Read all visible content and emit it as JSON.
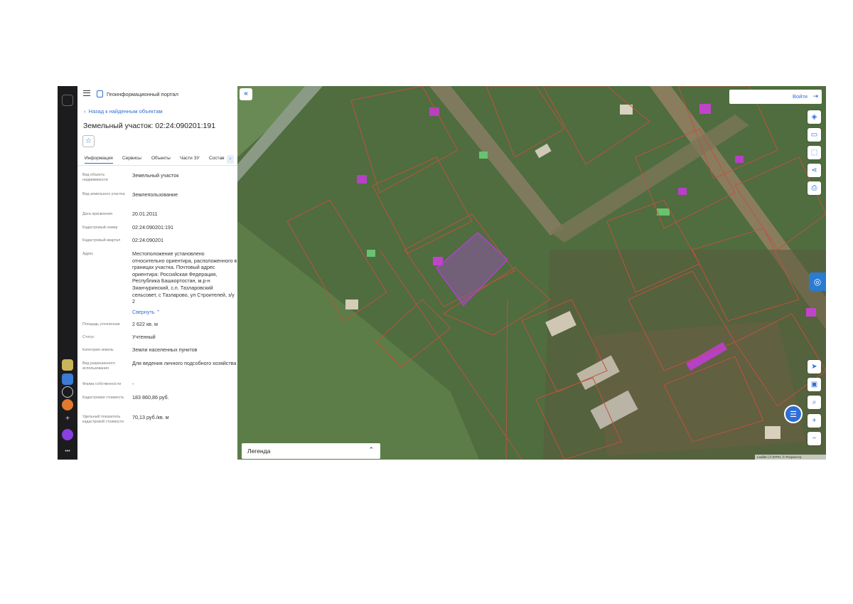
{
  "portal": {
    "title": "Геоинформационный портал"
  },
  "nav": {
    "back_link": "Назад к найденным объектам"
  },
  "object": {
    "title": "Земельный участок: 02:24:090201:191"
  },
  "tabs": [
    "Информация",
    "Сервисы",
    "Объекты",
    "Части ЗУ",
    "Состав"
  ],
  "details": [
    {
      "label": "Вид объекта недвижимости",
      "value": "Земельный участок"
    },
    {
      "label": "Вид земельного участка",
      "value": "Землепользование"
    },
    {
      "label": "Дата присвоения",
      "value": "20.01.2011"
    },
    {
      "label": "Кадастровый номер",
      "value": "02:24:090201:191"
    },
    {
      "label": "Кадастровый квартал",
      "value": "02:24:090201"
    },
    {
      "label": "Адрес",
      "value": "Местоположение установлено относительно ориентира, расположенного в границах участка. Почтовый адрес ориентира: Российская Федерация, Республика Башкортостан, м.р-н Зианчуринский, с.п. Тазларовский сельсовет, с Тазларово, ул Строителей, з/у 2",
      "link": "Свернуть ⌃"
    },
    {
      "label": "Площадь уточненная",
      "value": "2 622 кв. м"
    },
    {
      "label": "Статус",
      "value": "Учтенный"
    },
    {
      "label": "Категория земель",
      "value": "Земли населенных пунктов"
    },
    {
      "label": "Вид разрешенного использования",
      "value": "Для ведения личного подсобного хозяйства"
    },
    {
      "label": "Форма собственности",
      "value": "-"
    },
    {
      "label": "Кадастровая стоимость",
      "value": "183 860,86 руб."
    },
    {
      "label": "Удельный показатель кадастровой стоимости",
      "value": "70,13 руб./кв. м"
    }
  ],
  "map": {
    "login_label": "Войти",
    "legend_label": "Легенда",
    "scale_text": "Leaflet | © ЕГРН, © Росреестр"
  },
  "icons": {
    "menu": "menu-icon",
    "back": "chevron-left-icon",
    "favorite": "star-icon",
    "login": "login-icon",
    "collapse": "double-chevron-left-icon",
    "layers": "layers-icon",
    "ruler": "ruler-icon",
    "select-area": "select-area-icon",
    "share": "share-icon",
    "print": "print-icon",
    "locate": "location-arrow-icon",
    "screen": "screen-icon",
    "search-map": "search-map-icon",
    "zoom-in": "plus-icon",
    "zoom-out": "minus-icon",
    "chat": "chat-icon"
  },
  "colors": {
    "accent": "#2f6fd6",
    "selected_parcel": "#9b4fbd",
    "parcel_border": "#c0523f",
    "rail": "#1c1c1f"
  }
}
